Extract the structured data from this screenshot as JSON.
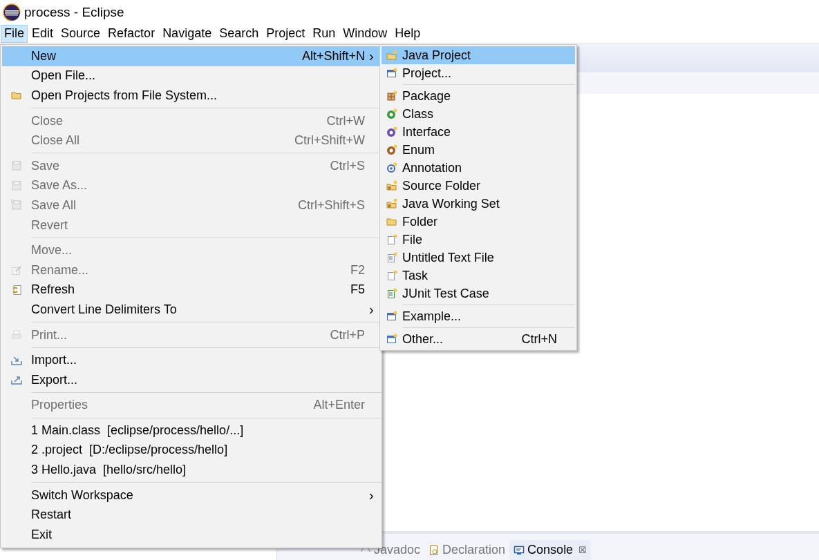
{
  "window": {
    "title": "process - Eclipse"
  },
  "menubar": [
    {
      "label": "File",
      "selected": true
    },
    {
      "label": "Edit",
      "selected": false
    },
    {
      "label": "Source",
      "selected": false
    },
    {
      "label": "Refactor",
      "selected": false
    },
    {
      "label": "Navigate",
      "selected": false
    },
    {
      "label": "Search",
      "selected": false
    },
    {
      "label": "Project",
      "selected": false
    },
    {
      "label": "Run",
      "selected": false
    },
    {
      "label": "Window",
      "selected": false
    },
    {
      "label": "Help",
      "selected": false
    }
  ],
  "file_menu": [
    {
      "kind": "item",
      "label": "New",
      "shortcut": "Alt+Shift+N",
      "arrow": "›",
      "disabled": false,
      "selected": true
    },
    {
      "kind": "item",
      "label": "Open File...",
      "disabled": false,
      "selected": false
    },
    {
      "kind": "item",
      "label": "Open Projects from File System...",
      "disabled": false,
      "selected": false
    },
    {
      "kind": "separator"
    },
    {
      "kind": "item",
      "label": "Close",
      "shortcut": "Ctrl+W",
      "disabled": true,
      "selected": false
    },
    {
      "kind": "item",
      "label": "Close All",
      "shortcut": "Ctrl+Shift+W",
      "disabled": true,
      "selected": false
    },
    {
      "kind": "separator"
    },
    {
      "kind": "item",
      "label": "Save",
      "shortcut": "Ctrl+S",
      "disabled": true,
      "selected": false
    },
    {
      "kind": "item",
      "label": "Save As...",
      "disabled": true,
      "selected": false
    },
    {
      "kind": "item",
      "label": "Save All",
      "shortcut": "Ctrl+Shift+S",
      "disabled": true,
      "selected": false
    },
    {
      "kind": "item",
      "label": "Revert",
      "disabled": true,
      "selected": false
    },
    {
      "kind": "separator"
    },
    {
      "kind": "item",
      "label": "Move...",
      "disabled": true,
      "selected": false
    },
    {
      "kind": "item",
      "label": "Rename...",
      "shortcut": "F2",
      "disabled": true,
      "selected": false
    },
    {
      "kind": "item",
      "label": "Refresh",
      "shortcut": "F5",
      "disabled": false,
      "selected": false
    },
    {
      "kind": "item",
      "label": "Convert Line Delimiters To",
      "arrow": "›",
      "disabled": false,
      "selected": false
    },
    {
      "kind": "separator"
    },
    {
      "kind": "item",
      "label": "Print...",
      "shortcut": "Ctrl+P",
      "disabled": true,
      "selected": false
    },
    {
      "kind": "separator"
    },
    {
      "kind": "item",
      "label": "Import...",
      "disabled": false,
      "selected": false
    },
    {
      "kind": "item",
      "label": "Export...",
      "disabled": false,
      "selected": false
    },
    {
      "kind": "separator"
    },
    {
      "kind": "item",
      "label": "Properties",
      "shortcut": "Alt+Enter",
      "disabled": true,
      "selected": false
    },
    {
      "kind": "separator"
    },
    {
      "kind": "item",
      "label": "1 Main.class  [eclipse/process/hello/...]",
      "disabled": false,
      "selected": false
    },
    {
      "kind": "item",
      "label": "2 .project  [D:/eclipse/process/hello]",
      "disabled": false,
      "selected": false
    },
    {
      "kind": "item",
      "label": "3 Hello.java  [hello/src/hello]",
      "disabled": false,
      "selected": false
    },
    {
      "kind": "separator"
    },
    {
      "kind": "item",
      "label": "Switch Workspace",
      "arrow": "›",
      "disabled": false,
      "selected": false
    },
    {
      "kind": "item",
      "label": "Restart",
      "disabled": false,
      "selected": false
    },
    {
      "kind": "item",
      "label": "Exit",
      "disabled": false,
      "selected": false
    }
  ],
  "new_submenu": [
    {
      "kind": "item",
      "label": "Java Project",
      "selected": true
    },
    {
      "kind": "item",
      "label": "Project...",
      "selected": false
    },
    {
      "kind": "separator"
    },
    {
      "kind": "item",
      "label": "Package",
      "selected": false
    },
    {
      "kind": "item",
      "label": "Class",
      "selected": false
    },
    {
      "kind": "item",
      "label": "Interface",
      "selected": false
    },
    {
      "kind": "item",
      "label": "Enum",
      "selected": false
    },
    {
      "kind": "item",
      "label": "Annotation",
      "selected": false
    },
    {
      "kind": "item",
      "label": "Source Folder",
      "selected": false
    },
    {
      "kind": "item",
      "label": "Java Working Set",
      "selected": false
    },
    {
      "kind": "item",
      "label": "Folder",
      "selected": false
    },
    {
      "kind": "item",
      "label": "File",
      "selected": false
    },
    {
      "kind": "item",
      "label": "Untitled Text File",
      "selected": false
    },
    {
      "kind": "item",
      "label": "Task",
      "selected": false
    },
    {
      "kind": "item",
      "label": "JUnit Test Case",
      "selected": false
    },
    {
      "kind": "separator"
    },
    {
      "kind": "item",
      "label": "Example...",
      "selected": false
    },
    {
      "kind": "separator"
    },
    {
      "kind": "item",
      "label": "Other...",
      "shortcut": "Ctrl+N",
      "selected": false
    }
  ],
  "bottom_tabs": [
    {
      "label": "Javadoc",
      "selected": false
    },
    {
      "label": "Declaration",
      "selected": false
    },
    {
      "label": "Console",
      "selected": true,
      "close": "☒"
    }
  ]
}
